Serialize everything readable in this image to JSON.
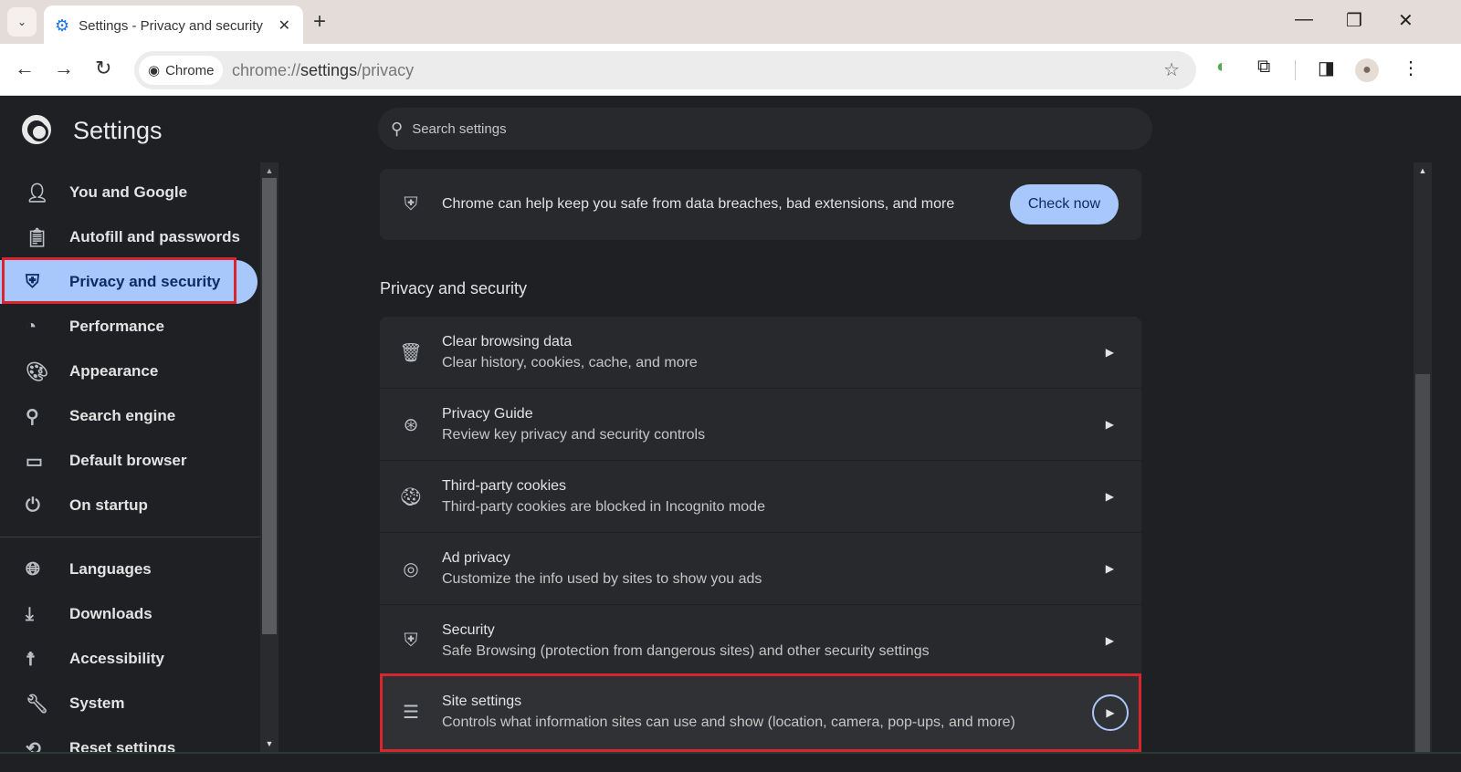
{
  "tab": {
    "title": "Settings - Privacy and security",
    "icon": "gear-icon"
  },
  "toolbar": {
    "chip": "Chrome",
    "url_prefix": "chrome://",
    "url_host": "settings",
    "url_path": "/privacy"
  },
  "header": {
    "title": "Settings",
    "search_placeholder": "Search settings"
  },
  "sidebar": {
    "items": [
      {
        "label": "You and Google",
        "icon": "person-icon"
      },
      {
        "label": "Autofill and passwords",
        "icon": "clipboard-icon"
      },
      {
        "label": "Privacy and security",
        "icon": "shield-icon",
        "selected": true
      },
      {
        "label": "Performance",
        "icon": "gauge-icon"
      },
      {
        "label": "Appearance",
        "icon": "palette-icon"
      },
      {
        "label": "Search engine",
        "icon": "search-icon"
      },
      {
        "label": "Default browser",
        "icon": "browser-icon"
      },
      {
        "label": "On startup",
        "icon": "power-icon"
      },
      {
        "label": "Languages",
        "icon": "globe-icon"
      },
      {
        "label": "Downloads",
        "icon": "download-icon"
      },
      {
        "label": "Accessibility",
        "icon": "accessibility-icon"
      },
      {
        "label": "System",
        "icon": "wrench-icon"
      },
      {
        "label": "Reset settings",
        "icon": "history-icon"
      }
    ]
  },
  "safety": {
    "text": "Chrome can help keep you safe from data breaches, bad extensions, and more",
    "button": "Check now"
  },
  "section": {
    "title": "Privacy and security",
    "rows": [
      {
        "title": "Clear browsing data",
        "desc": "Clear history, cookies, cache, and more",
        "icon": "trash-icon"
      },
      {
        "title": "Privacy Guide",
        "desc": "Review key privacy and security controls",
        "icon": "compass-icon"
      },
      {
        "title": "Third-party cookies",
        "desc": "Third-party cookies are blocked in Incognito mode",
        "icon": "cookie-icon"
      },
      {
        "title": "Ad privacy",
        "desc": "Customize the info used by sites to show you ads",
        "icon": "ad-privacy-icon"
      },
      {
        "title": "Security",
        "desc": "Safe Browsing (protection from dangerous sites) and other security settings",
        "icon": "shield-icon"
      },
      {
        "title": "Site settings",
        "desc": "Controls what information sites can use and show (location, camera, pop-ups, and more)",
        "icon": "sliders-icon"
      }
    ]
  },
  "colors": {
    "accent": "#a8c7fa",
    "highlight": "#d9262e",
    "background": "#1f2023"
  }
}
